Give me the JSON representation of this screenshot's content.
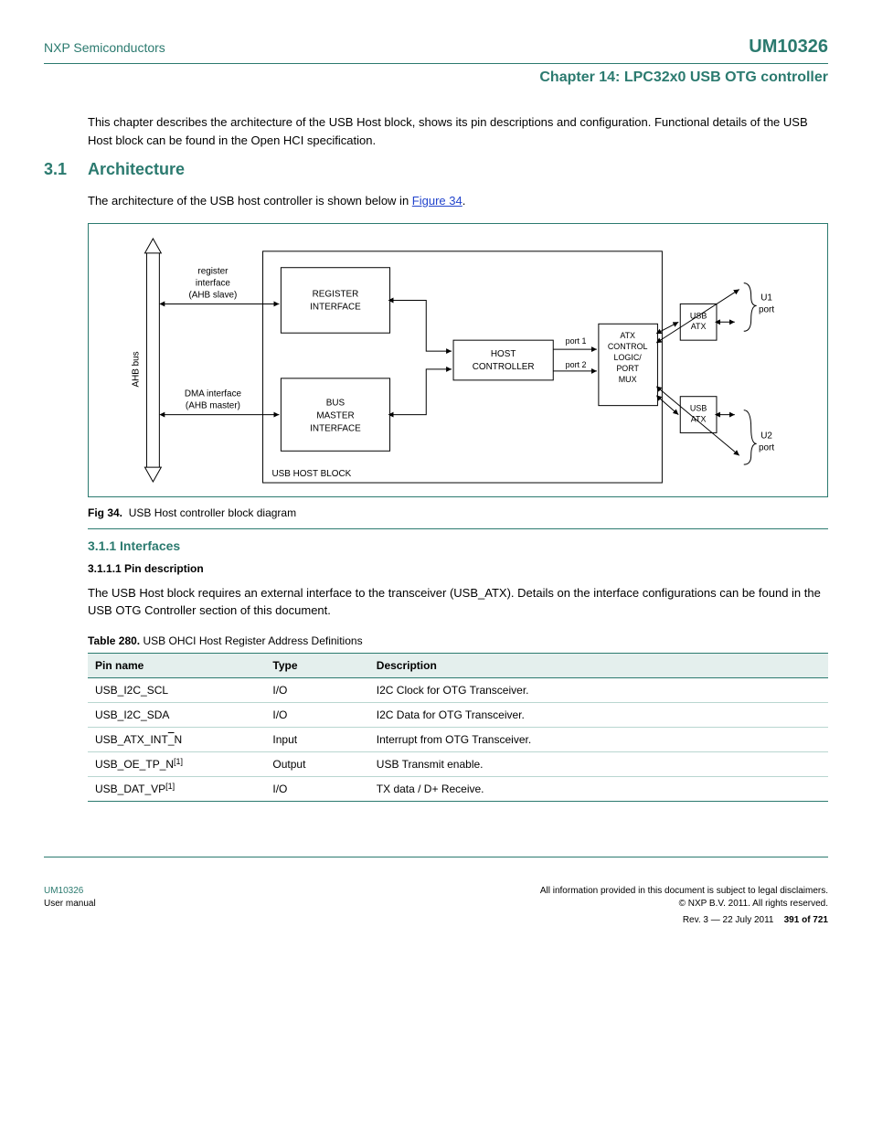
{
  "header": {
    "company": "NXP Semiconductors",
    "doc": "UM10326",
    "subtitle": "Chapter 14: LPC32x0 USB OTG controller"
  },
  "intro": {
    "text1": "This chapter describes the architecture of the USB Host block, shows its pin descriptions and configuration. Functional details of the USB Host block can be found in the Open HCI specification."
  },
  "sections": {
    "arch_num": "3.1",
    "arch_title": "Architecture",
    "arch_text": "The architecture of the USB host controller is shown below in ",
    "arch_link": "Figure 34",
    "interfaces_title": "3.1.1   Interfaces",
    "pinDesc_title": "3.1.1.1  Pin description",
    "pinDesc_text": "The USB Host block requires an external interface to the transceiver (USB_ATX). Details on the interface configurations can be found in the USB OTG Controller section of this document."
  },
  "figure": {
    "caption_bold": "Fig 34.",
    "caption_text": "USB Host controller block diagram",
    "labels": {
      "ahb_bus": "AHB bus",
      "reg_if_a": "register",
      "reg_if_b": "interface",
      "reg_if_c": "(AHB slave)",
      "dma_a": "DMA interface",
      "dma_b": "(AHB master)",
      "reg_box_a": "REGISTER",
      "reg_box_b": "INTERFACE",
      "bus_box_a": "BUS",
      "bus_box_b": "MASTER",
      "bus_box_c": "INTERFACE",
      "host_a": "HOST",
      "host_b": "CONTROLLER",
      "atx_a": "ATX",
      "atx_b": "CONTROL",
      "atx_c": "LOGIC/",
      "atx_d": "PORT",
      "atx_e": "MUX",
      "usb_atx": "USB",
      "usb_atx2": "ATX",
      "port1": "port 1",
      "port2": "port 2",
      "u1a": "U1",
      "u1b": "port",
      "u2a": "U2",
      "u2b": "port",
      "block_label": "USB HOST BLOCK"
    }
  },
  "table": {
    "caption_bold": "Table 280.",
    "caption_text": "USB OHCI Host Register Address Definitions",
    "headers": [
      "Pin name",
      "Type",
      "Description"
    ],
    "rows": [
      {
        "pin": "USB_I2C_SCL",
        "type": "I/O",
        "desc": "I2C Clock for OTG Transceiver."
      },
      {
        "pin": "USB_I2C_SDA",
        "type": "I/O",
        "desc": "I2C Data for OTG Transceiver."
      },
      {
        "pin_html": "USB_ATX_INT<span class='overline'>_</span>N",
        "pin": "USB_ATX_INT_N",
        "type": "Input",
        "desc": "Interrupt from OTG Transceiver."
      },
      {
        "pin_html": "USB_OE_TP_N<span class='super'>[1]</span>",
        "pin": "USB_OE_TP_N",
        "type": "Output",
        "desc": "USB Transmit enable."
      },
      {
        "pin_html": "USB_DAT_VP<span class='super'>[1]</span>",
        "pin": "USB_DAT_VP",
        "type": "I/O",
        "desc": "TX data / D+ Receive."
      }
    ]
  },
  "footer": {
    "left_line1a": "UM10326",
    "left_line2": "User manual",
    "right1": "All information provided in this document is subject to legal disclaimers.",
    "right2": "© NXP B.V. 2011. All rights reserved.",
    "right3": "Rev. 3 — 22 July 2011",
    "right4": "391 of 721"
  }
}
